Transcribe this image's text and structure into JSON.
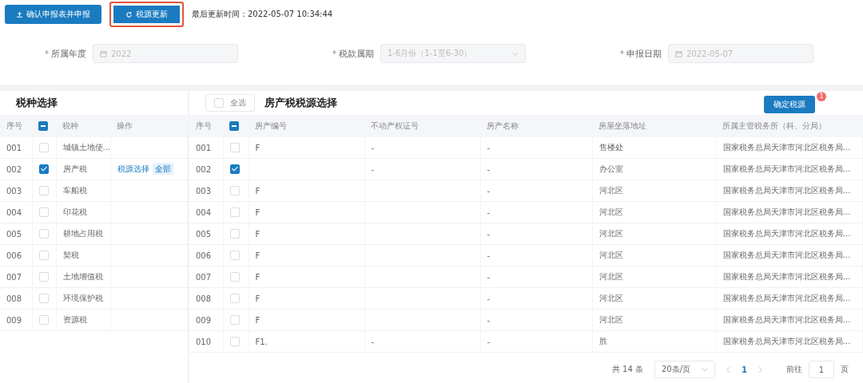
{
  "toolbar": {
    "buttons": [
      {
        "label": "确认申报表并申报",
        "kind": "upload",
        "highlighted": false
      },
      {
        "label": "税源更新",
        "kind": "refresh",
        "highlighted": true
      }
    ],
    "last_update": "最后更新时间：2022-05-07 10:34:44"
  },
  "form": [
    {
      "label": "所属年度",
      "required_mark": "*",
      "value": "2022",
      "kind": "date",
      "disabled": true
    },
    {
      "label": "税款属期",
      "required_mark": "*",
      "value": "1-6月份（1-1至6-30）",
      "kind": "select",
      "disabled": true
    },
    {
      "label": "申报日期",
      "required_mark": "*",
      "value": "2022-05-07",
      "kind": "date",
      "disabled": true
    }
  ],
  "tax_types": {
    "title": "税种选择",
    "header_indeterminate": true,
    "columns": [
      "序号",
      "税种",
      "操作"
    ],
    "rows": [
      {
        "no": "001",
        "name": "城镇土地使...",
        "checked": false
      },
      {
        "no": "002",
        "name": "房产税",
        "checked": true,
        "actions": [
          {
            "label": "税源选择",
            "kind": "link"
          },
          {
            "label": "全部",
            "kind": "tag"
          }
        ]
      },
      {
        "no": "003",
        "name": "车船税",
        "checked": false
      },
      {
        "no": "004",
        "name": "印花税",
        "checked": false
      },
      {
        "no": "005",
        "name": "耕地占用税",
        "checked": false
      },
      {
        "no": "006",
        "name": "契税",
        "checked": false
      },
      {
        "no": "007",
        "name": "土地增值税",
        "checked": false
      },
      {
        "no": "008",
        "name": "环境保护税",
        "checked": false
      },
      {
        "no": "009",
        "name": "资源税",
        "checked": false
      }
    ]
  },
  "sources": {
    "select_all": {
      "label": "全选",
      "checked": false
    },
    "title": "房产税税源选择",
    "confirm": {
      "label": "确定税源",
      "badge": "1"
    },
    "header_indeterminate": true,
    "columns": [
      "序号",
      "房产编号",
      "不动产权证号",
      "房产名称",
      "房屋坐落地址",
      "所属主管税务所（科、分局）"
    ],
    "rows": [
      {
        "no": "001",
        "checked": false,
        "id": "F",
        "cert": "-",
        "name": "-",
        "address": "售楼处",
        "office": "国家税务总局天津市河北区税务局…"
      },
      {
        "no": "002",
        "checked": true,
        "cert": "-",
        "name": "-",
        "address": "办公室",
        "office": "国家税务总局天津市河北区税务局…"
      },
      {
        "no": "003",
        "checked": false,
        "id": "F",
        "name": "-",
        "address": "河北区",
        "office": "国家税务总局天津市河北区税务局…"
      },
      {
        "no": "004",
        "checked": false,
        "id": "F",
        "name": "-",
        "address": "河北区",
        "office": "国家税务总局天津市河北区税务局…"
      },
      {
        "no": "005",
        "checked": false,
        "id": "F",
        "name": "-",
        "address": "河北区",
        "office": "国家税务总局天津市河北区税务局…"
      },
      {
        "no": "006",
        "checked": false,
        "id": "F",
        "name": "-",
        "address": "河北区",
        "office": "国家税务总局天津市河北区税务局…"
      },
      {
        "no": "007",
        "checked": false,
        "id": "F",
        "name": "-",
        "address": "河北区",
        "office": "国家税务总局天津市河北区税务局…"
      },
      {
        "no": "008",
        "checked": false,
        "id": "F",
        "name": "-",
        "address": "河北区",
        "office": "国家税务总局天津市河北区税务局…"
      },
      {
        "no": "009",
        "checked": false,
        "id": "F",
        "name": "-",
        "address": "河北区",
        "office": "国家税务总局天津市河北区税务局…"
      },
      {
        "no": "010",
        "checked": false,
        "id": "F1.",
        "cert": "-",
        "name": "-",
        "address": "胜",
        "office": "国家税务总局天津市河北区税务局…"
      }
    ],
    "pagination": {
      "total": "共 14 条",
      "page_size": "20条/页",
      "page": "1",
      "goto_label": "前往",
      "goto_value": "1",
      "page_unit": "页"
    }
  }
}
